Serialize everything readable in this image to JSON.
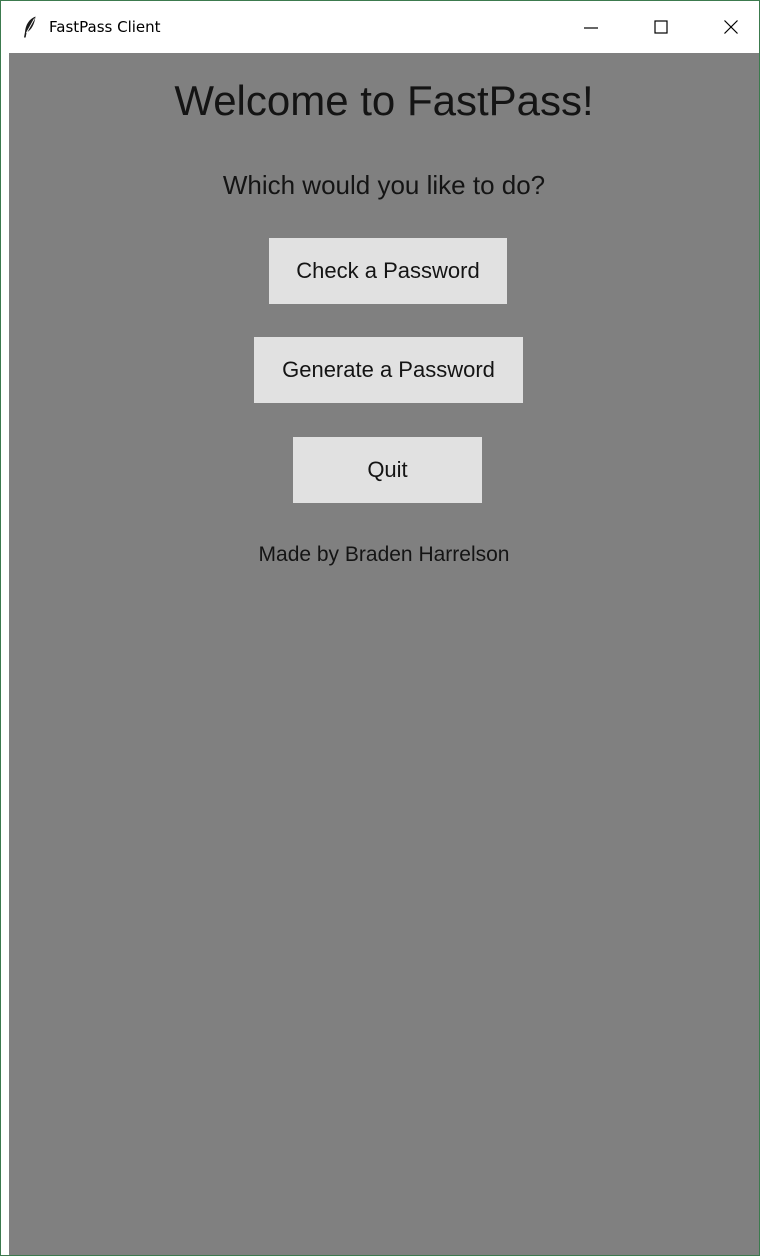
{
  "window": {
    "title": "FastPass Client",
    "icons": {
      "app": "feather-icon",
      "minimize": "minimize-icon",
      "maximize": "maximize-icon",
      "close": "close-icon"
    }
  },
  "main": {
    "heading": "Welcome to FastPass!",
    "prompt": "Which would you like to do?",
    "buttons": {
      "check": "Check a Password",
      "generate": "Generate a Password",
      "quit": "Quit"
    },
    "credit": "Made by Braden Harrelson"
  },
  "colors": {
    "background": "#808080",
    "button": "#e1e1e1",
    "text": "#141414",
    "titlebar": "#ffffff"
  }
}
